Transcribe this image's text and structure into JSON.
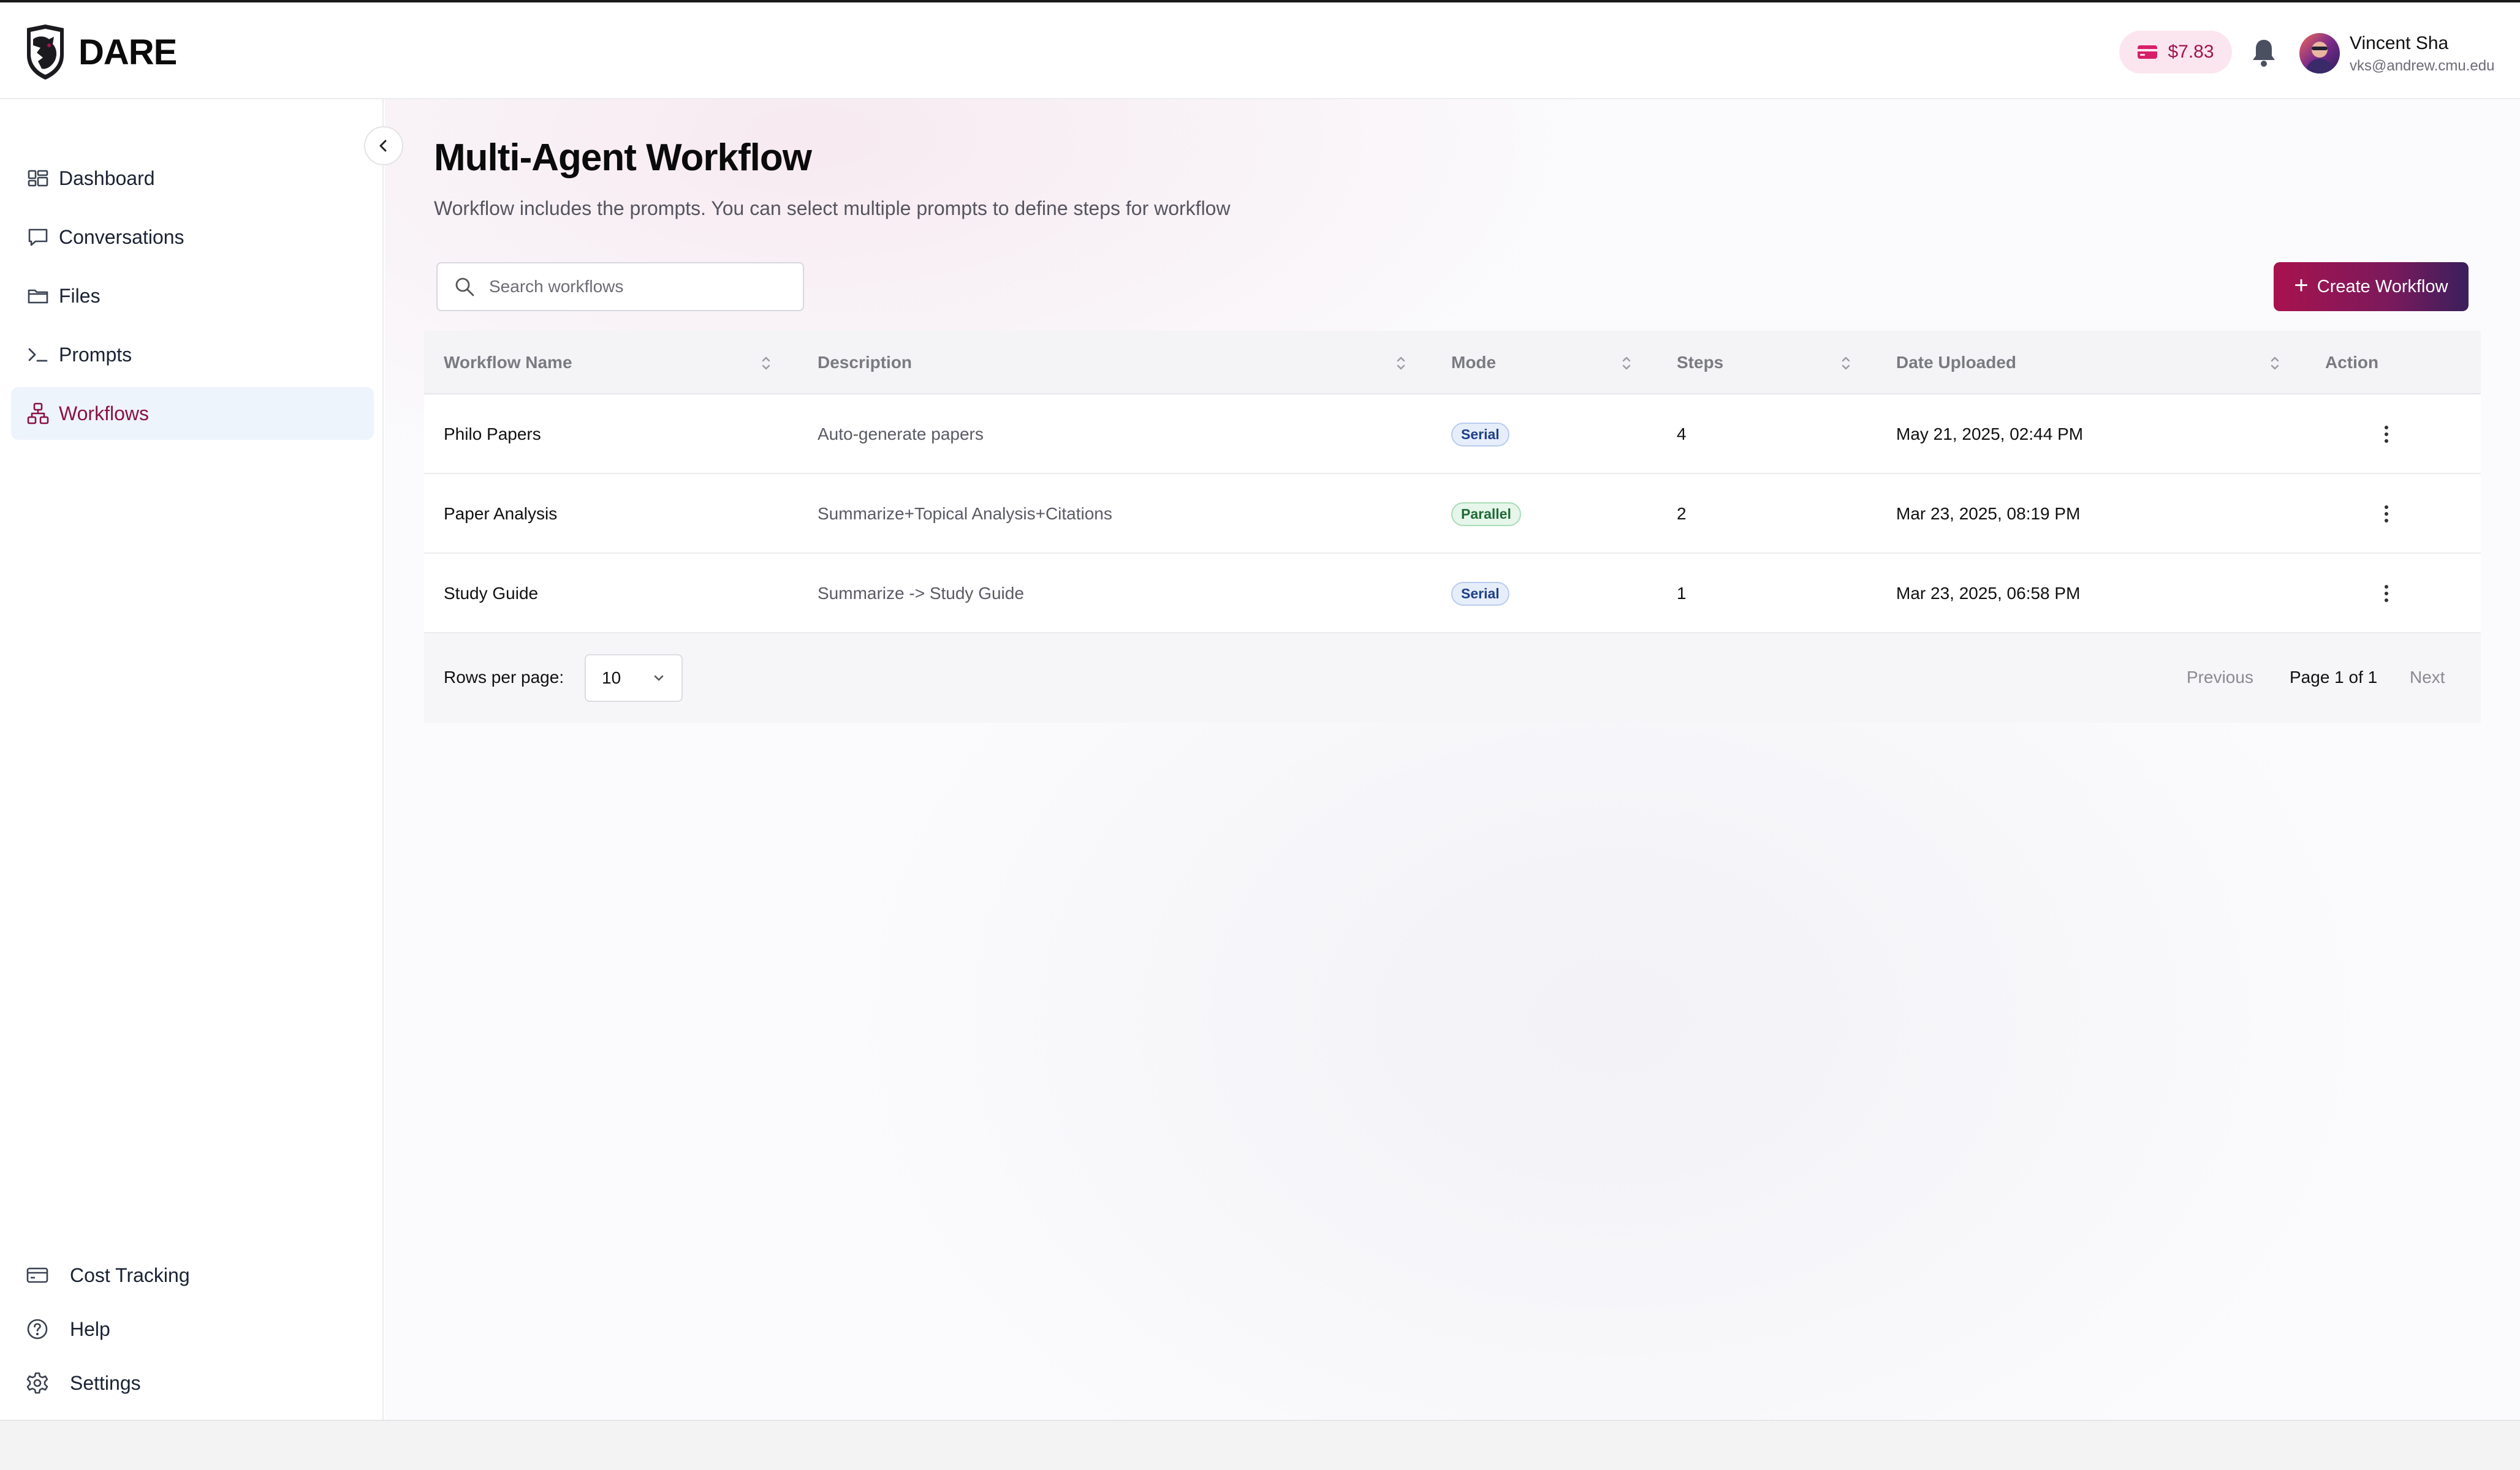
{
  "app": {
    "brand": "DARE",
    "credit": "$7.83",
    "user": {
      "name": "Vincent Sha",
      "email": "vks@andrew.cmu.edu"
    },
    "accent_color": "#a8124e"
  },
  "sidebar": {
    "items": [
      {
        "label": "Dashboard",
        "icon": "dashboard-icon",
        "active": false
      },
      {
        "label": "Conversations",
        "icon": "chat-bubble-icon",
        "active": false
      },
      {
        "label": "Files",
        "icon": "folder-icon",
        "active": false
      },
      {
        "label": "Prompts",
        "icon": "terminal-prompt-icon",
        "active": false
      },
      {
        "label": "Workflows",
        "icon": "workflow-icon",
        "active": true
      }
    ],
    "bottom_items": [
      {
        "label": "Cost Tracking",
        "icon": "credit-card-icon"
      },
      {
        "label": "Help",
        "icon": "help-circle-icon"
      },
      {
        "label": "Settings",
        "icon": "gear-icon"
      }
    ]
  },
  "page": {
    "title": "Multi-Agent Workflow",
    "subtitle": "Workflow includes the prompts. You can select multiple prompts to define steps for workflow",
    "search_placeholder": "Search workflows",
    "create_label": "Create Workflow"
  },
  "table": {
    "columns": [
      "Workflow Name",
      "Description",
      "Mode",
      "Steps",
      "Date Uploaded",
      "Action"
    ],
    "rows": [
      {
        "name": "Philo Papers",
        "description": "Auto-generate papers",
        "mode": "Serial",
        "steps": "4",
        "date": "May 21, 2025, 02:44 PM"
      },
      {
        "name": "Paper Analysis",
        "description": "Summarize+Topical Analysis+Citations",
        "mode": "Parallel",
        "steps": "2",
        "date": "Mar 23, 2025, 08:19 PM"
      },
      {
        "name": "Study Guide",
        "description": "Summarize -> Study Guide",
        "mode": "Serial",
        "steps": "1",
        "date": "Mar 23, 2025, 06:58 PM"
      }
    ]
  },
  "pagination": {
    "rows_per_page_label": "Rows per page:",
    "rows_per_page": "10",
    "previous": "Previous",
    "page_info": "Page 1 of 1",
    "next": "Next"
  }
}
